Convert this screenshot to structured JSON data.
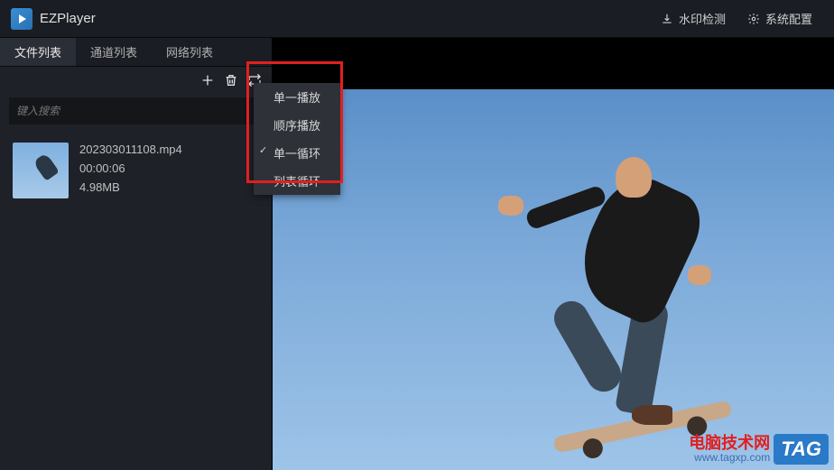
{
  "app": {
    "title": "EZPlayer"
  },
  "titlebar": {
    "watermark_btn": "水印检测",
    "settings_btn": "系统配置"
  },
  "tabs": {
    "file_list": "文件列表",
    "channel_list": "通道列表",
    "network_list": "网络列表"
  },
  "toolbar_icons": {
    "add": "add-icon",
    "delete": "delete-icon",
    "loop": "loop-icon"
  },
  "search": {
    "placeholder": "键入搜索"
  },
  "file": {
    "name": "202303011108.mp4",
    "duration": "00:00:06",
    "size": "4.98MB"
  },
  "menu": {
    "items": [
      {
        "label": "单一播放",
        "checked": false
      },
      {
        "label": "顺序播放",
        "checked": false
      },
      {
        "label": "单一循环",
        "checked": true
      },
      {
        "label": "列表循环",
        "checked": false
      }
    ]
  },
  "watermark": {
    "line1": "电脑技术网",
    "line2": "www.tagxp.com",
    "tag": "TAG"
  }
}
